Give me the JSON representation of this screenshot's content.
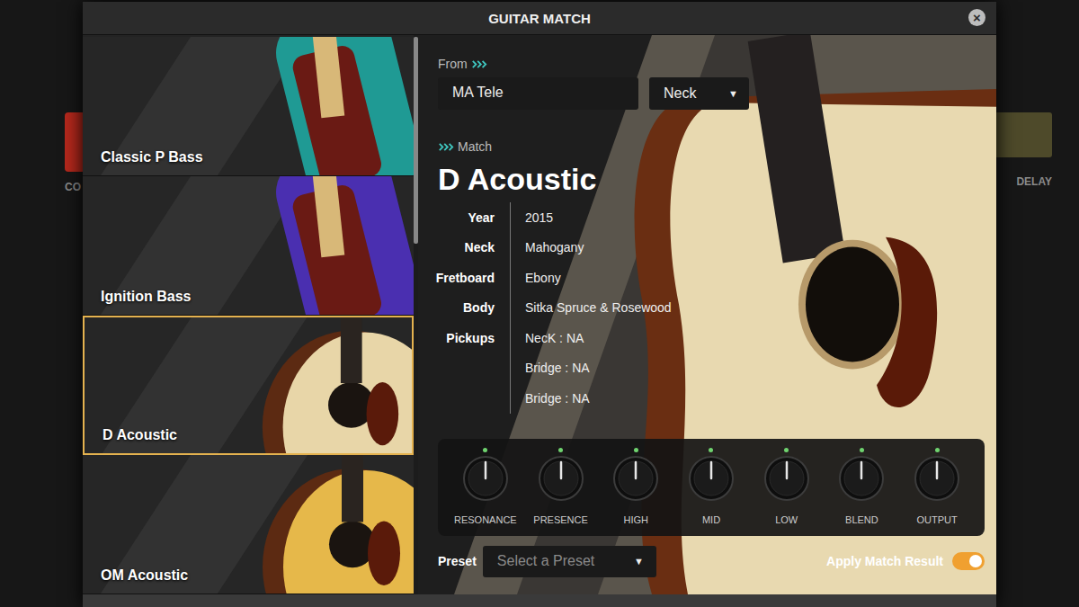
{
  "background": {
    "left_label": "CO",
    "right_label": "DELAY"
  },
  "window": {
    "title": "GUITAR MATCH",
    "close": "×"
  },
  "guitars": [
    {
      "name": "Classic P Bass",
      "selected": false,
      "kind": "bass",
      "color": "#1f9a94"
    },
    {
      "name": "Ignition Bass",
      "selected": false,
      "kind": "bass",
      "color": "#4a2fb0"
    },
    {
      "name": "D Acoustic",
      "selected": true,
      "kind": "acoustic",
      "color": "#a4532a"
    },
    {
      "name": "OM Acoustic",
      "selected": false,
      "kind": "acoustic",
      "color": "#d8a028"
    }
  ],
  "from": {
    "label": "From",
    "guitar": "MA Tele",
    "position": "Neck",
    "arrow": "▼"
  },
  "match": {
    "label": "Match",
    "name": "D Acoustic",
    "specs": [
      {
        "label": "Year",
        "value": "2015"
      },
      {
        "label": "Neck",
        "value": "Mahogany"
      },
      {
        "label": "Fretboard",
        "value": "Ebony"
      },
      {
        "label": "Body",
        "value": "Sitka Spruce & Rosewood"
      },
      {
        "label": "Pickups",
        "value": "NecK : NA"
      },
      {
        "label": "",
        "value": "Bridge : NA"
      },
      {
        "label": "",
        "value": "Bridge : NA"
      }
    ]
  },
  "knobs": [
    {
      "label": "RESONANCE",
      "level": 0.5
    },
    {
      "label": "PRESENCE",
      "level": 0.5
    },
    {
      "label": "HIGH",
      "level": 0.5
    },
    {
      "label": "MID",
      "level": 0.5
    },
    {
      "label": "LOW",
      "level": 0.5
    },
    {
      "label": "BLEND",
      "level": 0.5
    },
    {
      "label": "OUTPUT",
      "level": 0.5
    }
  ],
  "preset": {
    "label": "Preset",
    "placeholder": "Select a Preset",
    "arrow": "▼"
  },
  "apply": {
    "label": "Apply Match Result",
    "on": true
  }
}
